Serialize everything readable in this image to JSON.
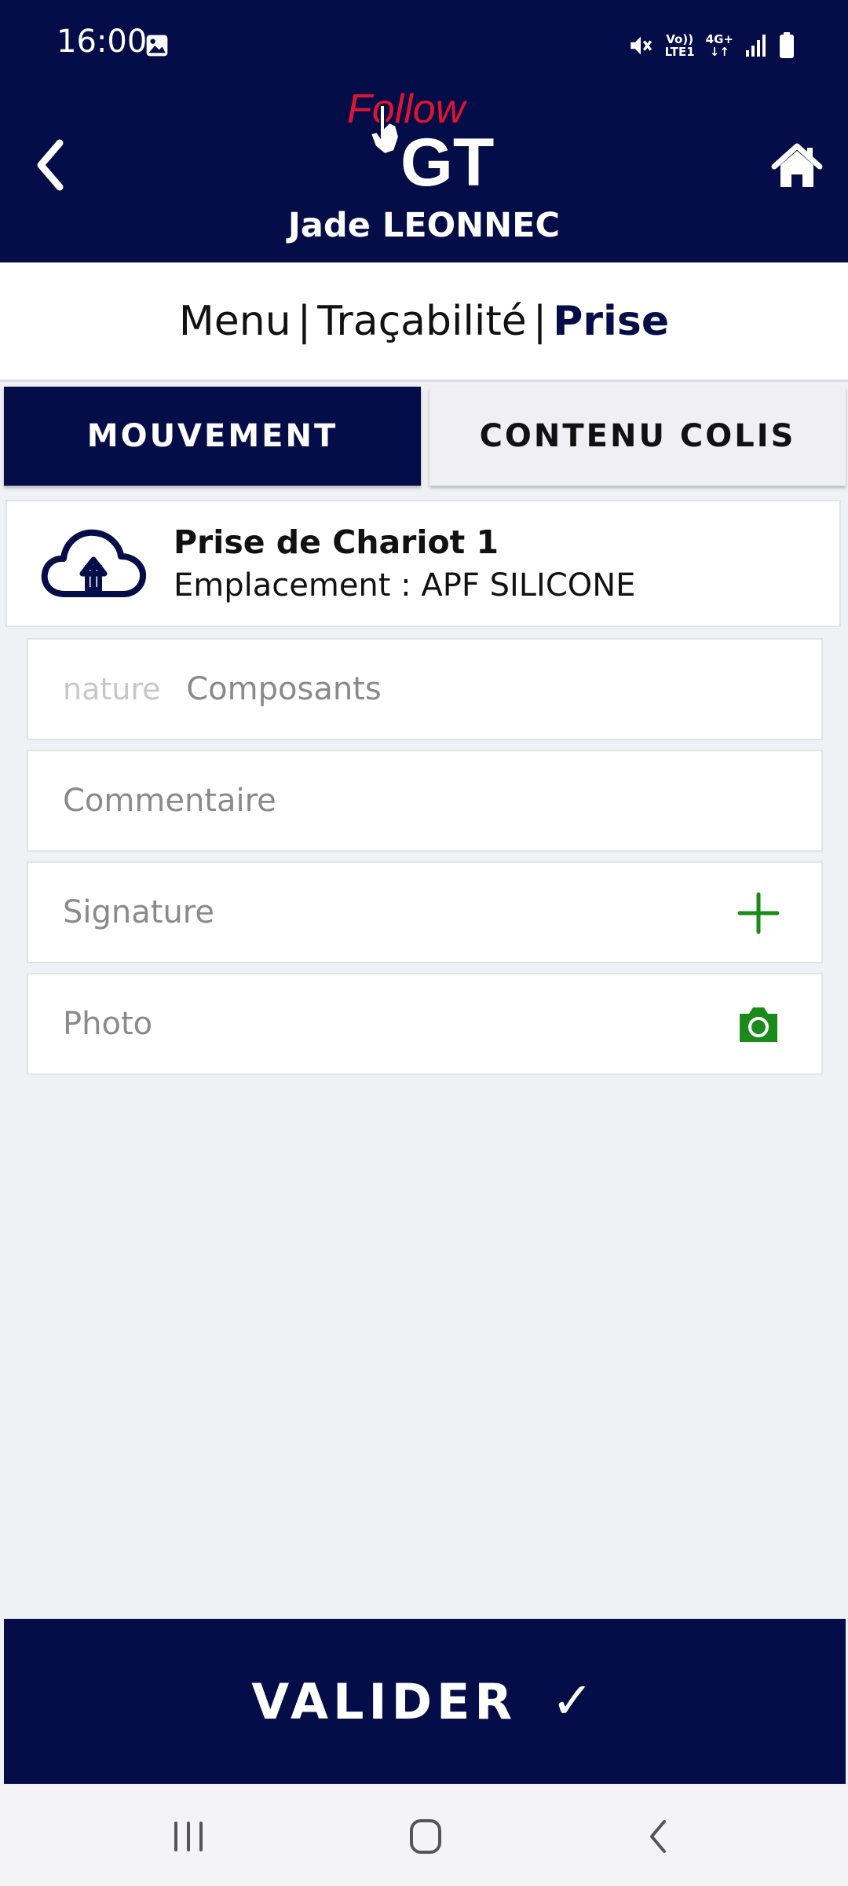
{
  "status_bar": {
    "time": "16:00",
    "network_top": "Vo))",
    "network_bottom": "LTE1",
    "network_type": "4G+",
    "icons": [
      "image-icon",
      "mute-icon",
      "signal-icon",
      "battery-icon"
    ]
  },
  "header": {
    "logo_word_top": "Follow",
    "logo_word_bottom": "GT",
    "user_name": "Jade LEONNEC",
    "back_icon": "chevron-left-icon",
    "home_icon": "home-icon",
    "colors": {
      "background": "#050d48",
      "logo_accent": "#e0142e"
    }
  },
  "breadcrumb": {
    "items": [
      "Menu",
      "Traçabilité"
    ],
    "separator": "|",
    "current": "Prise"
  },
  "tabs": [
    {
      "label": "MOUVEMENT",
      "active": true
    },
    {
      "label": "CONTENU COLIS",
      "active": false
    }
  ],
  "movement": {
    "icon": "cloud-upload-icon",
    "title": "Prise de Chariot 1",
    "location": "Emplacement : APF SILICONE"
  },
  "fields": {
    "nature": {
      "label": "nature",
      "value": "Composants"
    },
    "comment": {
      "placeholder": "Commentaire"
    },
    "signature": {
      "placeholder": "Signature",
      "icon": "plus-icon"
    },
    "photo": {
      "placeholder": "Photo",
      "icon": "camera-icon"
    },
    "icon_color": "#1a8a1a"
  },
  "actions": {
    "validate_label": "VALIDER",
    "validate_icon": "✓"
  },
  "navbar": {
    "items": [
      "recents-icon",
      "home-circle-icon",
      "back-icon"
    ]
  }
}
